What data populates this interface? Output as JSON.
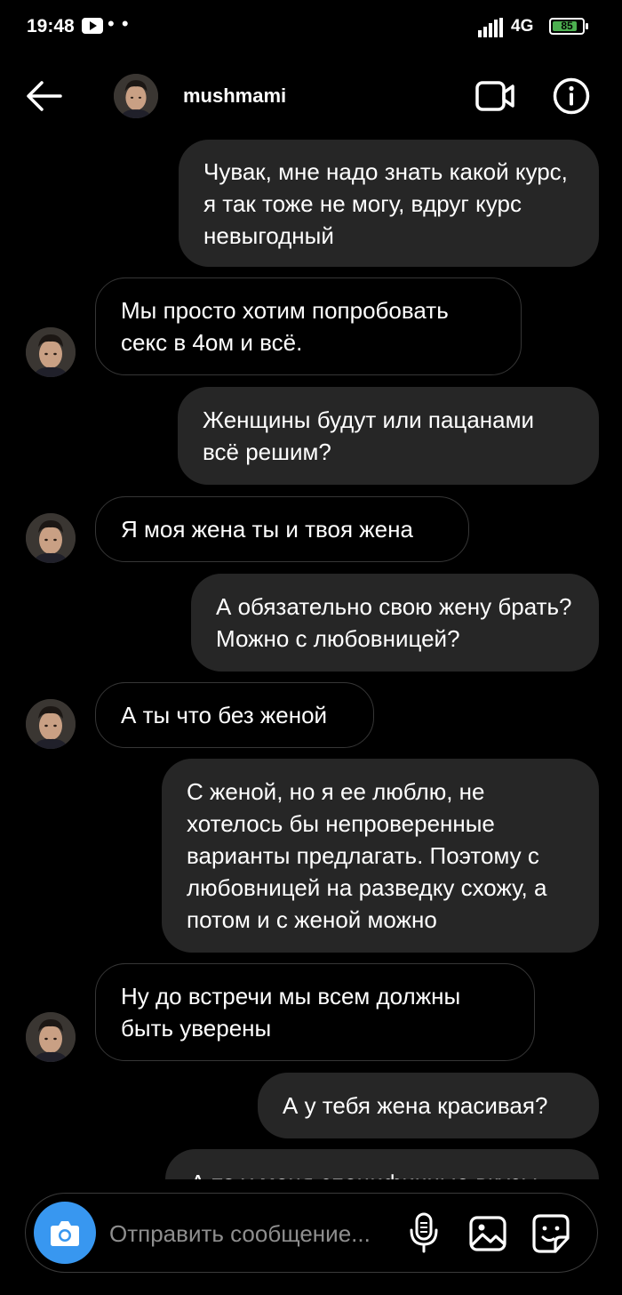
{
  "status_bar": {
    "time": "19:48",
    "dots": "• •",
    "network": "4G",
    "battery": "85",
    "battery_color": "#4caf50"
  },
  "header": {
    "username": "mushmami",
    "back_icon": "arrow-left-icon",
    "video_icon": "video-call-icon",
    "info_icon": "info-icon"
  },
  "messages": [
    {
      "direction": "outgoing",
      "text": "Чувак, мне надо знать какой курс, я так тоже не могу, вдруг курс невыгодный"
    },
    {
      "direction": "incoming",
      "text": "Мы просто хотим попробовать секс в 4ом и всё."
    },
    {
      "direction": "outgoing",
      "text": "Женщины будут или пацанами всё решим?"
    },
    {
      "direction": "incoming",
      "text": "Я моя жена ты и твоя жена"
    },
    {
      "direction": "outgoing",
      "text": "А обязательно свою жену брать? Можно с любовницей?"
    },
    {
      "direction": "incoming",
      "text": "А ты что без женой"
    },
    {
      "direction": "outgoing",
      "text": "С женой, но я ее люблю, не хотелось бы непроверенные варианты предлагать. Поэтому с любовницей на разведку схожу, а потом и с женой можно"
    },
    {
      "direction": "incoming",
      "text": "Ну до встречи мы всем должны быть уверены"
    },
    {
      "direction": "outgoing",
      "text": "А у тебя жена красивая?"
    },
    {
      "direction": "outgoing",
      "text": "А то у меня специфичные вкусы"
    }
  ],
  "composer": {
    "placeholder": "Отправить сообщение...",
    "camera_color": "#3897f0"
  }
}
